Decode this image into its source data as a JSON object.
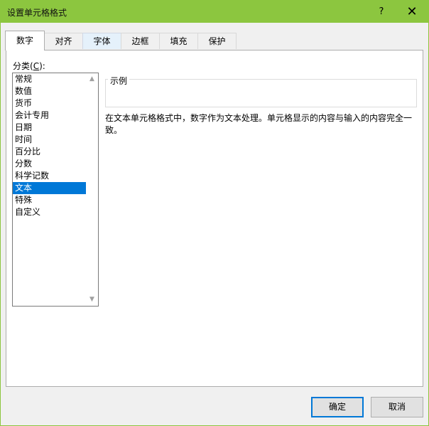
{
  "window": {
    "title": "设置单元格格式",
    "help": "?",
    "close": "✕"
  },
  "tabs": [
    {
      "label": "数字"
    },
    {
      "label": "对齐"
    },
    {
      "label": "字体"
    },
    {
      "label": "边框"
    },
    {
      "label": "填充"
    },
    {
      "label": "保护"
    }
  ],
  "category": {
    "label_prefix": "分类(",
    "label_key": "C",
    "label_suffix": "):",
    "items": [
      "常规",
      "数值",
      "货币",
      "会计专用",
      "日期",
      "时间",
      "百分比",
      "分数",
      "科学记数",
      "文本",
      "特殊",
      "自定义"
    ],
    "selected": "文本"
  },
  "sample": {
    "legend": "示例",
    "value": ""
  },
  "description": "在文本单元格格式中，数字作为文本处理。单元格显示的内容与输入的内容完全一致。",
  "buttons": {
    "ok": "确定",
    "cancel": "取消"
  },
  "colors": {
    "titlebar": "#8cc63f",
    "selection": "#0078d7",
    "default_button_border": "#0078d7"
  }
}
